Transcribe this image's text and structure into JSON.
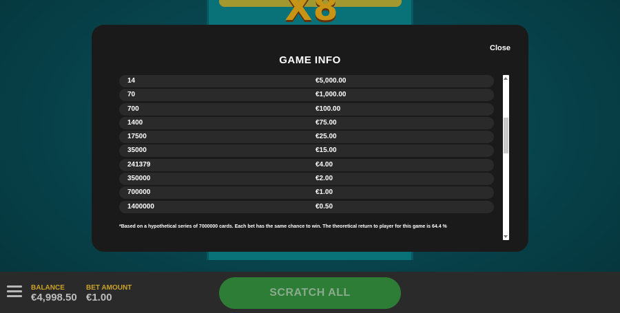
{
  "modal": {
    "title": "GAME INFO",
    "close_label": "Close",
    "rows": [
      {
        "count": "14",
        "prize": "€5,000.00"
      },
      {
        "count": "70",
        "prize": "€1,000.00"
      },
      {
        "count": "700",
        "prize": "€100.00"
      },
      {
        "count": "1400",
        "prize": "€75.00"
      },
      {
        "count": "17500",
        "prize": "€25.00"
      },
      {
        "count": "35000",
        "prize": "€15.00"
      },
      {
        "count": "241379",
        "prize": "€4.00"
      },
      {
        "count": "350000",
        "prize": "€2.00"
      },
      {
        "count": "700000",
        "prize": "€1.00"
      },
      {
        "count": "1400000",
        "prize": "€0.50"
      }
    ],
    "footnote": "*Based on a hypothetical series of 7000000 cards. Each bet has the same chance to win. The theoretical return to player for this game is 64.4 %"
  },
  "background": {
    "logo_text": "X8"
  },
  "bottom_bar": {
    "balance_label": "BALANCE",
    "balance_value": "€4,998.50",
    "bet_label": "BET AMOUNT",
    "bet_value": "€1.00",
    "scratch_all_label": "SCRATCH ALL"
  },
  "colors": {
    "accent_gold": "#c9a227",
    "button_green": "#2e7d36",
    "modal_bg": "#1a1a1a"
  }
}
